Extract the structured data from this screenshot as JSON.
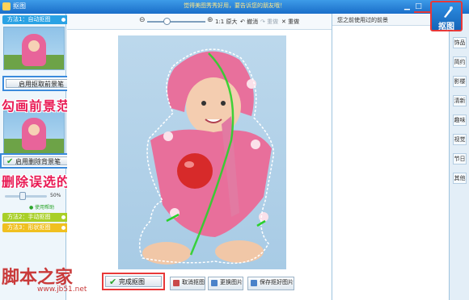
{
  "app": {
    "title": "抠图",
    "center_message": "觉得美图秀秀好用，要告诉您的朋友哦！",
    "window_buttons": [
      "minimize-icon",
      "maximize-icon",
      "close-icon"
    ]
  },
  "left_panel": {
    "method1": "方法1：自动抠图",
    "foreground_button": "启用抠取前景笔",
    "foreground_annotation": "勾画前景范围",
    "background_button": "启用删除背景笔",
    "background_annotation": "删除误选的抠取范围",
    "brush_size_pct": "50%",
    "brush_size_value": 0.5,
    "help_link": "● 使用帮助",
    "method2": "方法2：手动抠图",
    "method3": "方法3：形状抠图",
    "colors": {
      "method1": "#2aa2e4",
      "method2": "#a8cf27",
      "method3": "#f0c020"
    }
  },
  "toolbar": {
    "zoom_original": "1:1 原大",
    "undo": "撤消",
    "redo": "重做",
    "reset": "重做"
  },
  "right_panel": {
    "header": "您之前使用过的前景",
    "side_tabs": [
      "饰品",
      "简约",
      "影楼",
      "清新",
      "趣味",
      "视觉",
      "节日",
      "其他"
    ]
  },
  "top_right": {
    "koutu_label": "抠图"
  },
  "bottom": {
    "done": "完成抠图",
    "cancel": "取消抠图",
    "change_image": "更换图片",
    "save": "保存抠好图片"
  },
  "watermark": {
    "text": "脚本之家",
    "url": "www.jb51.net"
  }
}
